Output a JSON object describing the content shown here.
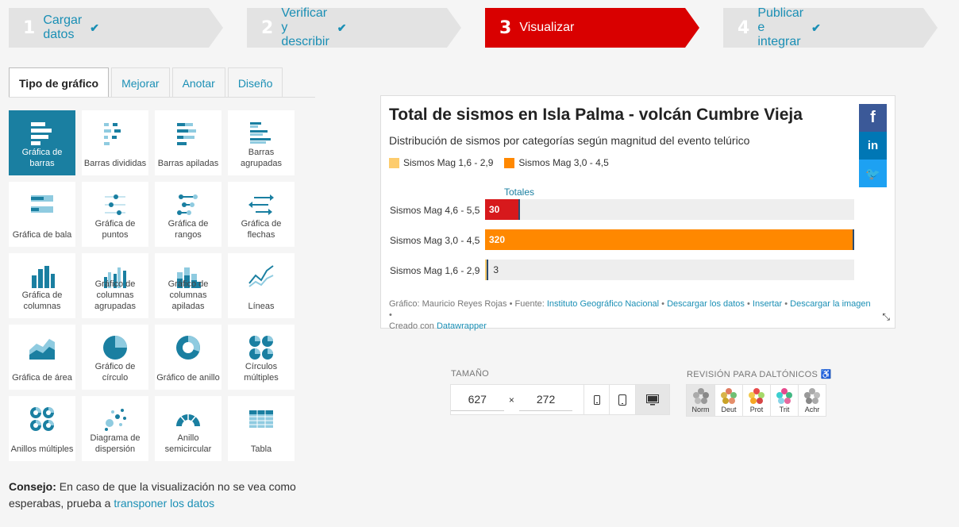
{
  "steps": [
    {
      "num": "1",
      "label": "Cargar datos",
      "check": "✔",
      "state": "done"
    },
    {
      "num": "2",
      "label": "Verificar y describir",
      "check": "✔",
      "state": "done"
    },
    {
      "num": "3",
      "label": "Visualizar",
      "check": "",
      "state": "active"
    },
    {
      "num": "4",
      "label": "Publicar e integrar",
      "check": "✔",
      "state": "done"
    }
  ],
  "tabs": [
    "Tipo de gráfico",
    "Mejorar",
    "Anotar",
    "Diseño"
  ],
  "chart_types": [
    {
      "label": "Gráfica de barras",
      "icon": "bar-chart-icon",
      "active": true
    },
    {
      "label": "Barras divididas",
      "icon": "split-bars-icon"
    },
    {
      "label": "Barras apiladas",
      "icon": "stacked-bars-icon"
    },
    {
      "label": "Barras agrupadas",
      "icon": "grouped-bars-icon"
    },
    {
      "label": "Gráfica de bala",
      "icon": "bullet-chart-icon"
    },
    {
      "label": "Gráfica de puntos",
      "icon": "dot-plot-icon"
    },
    {
      "label": "Gráfica de rangos",
      "icon": "range-plot-icon"
    },
    {
      "label": "Gráfica de flechas",
      "icon": "arrow-plot-icon"
    },
    {
      "label": "Gráfica de columnas",
      "icon": "column-chart-icon"
    },
    {
      "label": "Gráfico de columnas agrupadas",
      "icon": "grouped-columns-icon"
    },
    {
      "label": "Gráfico de columnas apiladas",
      "icon": "stacked-columns-icon"
    },
    {
      "label": "Líneas",
      "icon": "line-chart-icon"
    },
    {
      "label": "Gráfica de área",
      "icon": "area-chart-icon"
    },
    {
      "label": "Gráfico de círculo",
      "icon": "pie-chart-icon"
    },
    {
      "label": "Gráfico de anillo",
      "icon": "donut-chart-icon"
    },
    {
      "label": "Círculos múltiples",
      "icon": "multiple-pies-icon"
    },
    {
      "label": "Anillos múltiples",
      "icon": "multiple-donuts-icon"
    },
    {
      "label": "Diagrama de dispersión",
      "icon": "scatter-plot-icon"
    },
    {
      "label": "Anillo semicircular",
      "icon": "election-donut-icon"
    },
    {
      "label": "Tabla",
      "icon": "table-icon"
    }
  ],
  "tip": {
    "bold": "Consejo:",
    "text": " En caso de que la visualización no se vea como esperabas, prueba a ",
    "link": "transponer los datos"
  },
  "preview": {
    "title": "Total de sismos en Isla Palma - volcán Cumbre Vieja",
    "subtitle": "Distribución de sismos por categorías según magnitud del evento telúrico",
    "legend": [
      {
        "label": "Sismos Mag 1,6 - 2,9",
        "color": "#fdcc6d"
      },
      {
        "label": "Sismos Mag 3,0 - 4,5",
        "color": "#ff8800"
      }
    ],
    "column_header": "Totales",
    "footer": {
      "prefix": "Gráfico: Mauricio Reyes Rojas • Fuente: ",
      "source": "Instituto Geográfico Nacional",
      "sep1": " • ",
      "download": "Descargar los datos",
      "sep2": " • ",
      "embed": "Insertar",
      "sep3": " • ",
      "image": "Descargar la imagen",
      "sep4": " • ",
      "created": "Creado con ",
      "tool": "Datawrapper"
    },
    "social": [
      {
        "glyph": "f",
        "icon": "facebook-icon",
        "color": "#3b5998"
      },
      {
        "glyph": "in",
        "icon": "linkedin-icon",
        "color": "#0077b5"
      },
      {
        "glyph": "🐦",
        "icon": "twitter-icon",
        "color": "#1da1f2"
      }
    ]
  },
  "chart_data": {
    "type": "bar",
    "title": "Total de sismos en Isla Palma - volcán Cumbre Vieja",
    "subtitle": "Distribución de sismos por categorías según magnitud del evento telúrico",
    "categories": [
      "Sismos Mag 4,6 - 5,5",
      "Sismos Mag 3,0 - 4,5",
      "Sismos Mag 1,6 - 2,9"
    ],
    "values": [
      30,
      320,
      3
    ],
    "colors": [
      "#d7191c",
      "#ff8800",
      "#fdcc6d"
    ],
    "series": [
      {
        "name": "Totales",
        "values": [
          30,
          320,
          3
        ]
      }
    ],
    "xlim": [
      0,
      320
    ]
  },
  "size": {
    "label": "TAMAÑO",
    "width": "627",
    "times": "×",
    "height": "272",
    "devices": [
      "mobile-small-icon",
      "mobile-icon",
      "desktop-icon"
    ]
  },
  "colorblind": {
    "label": "REVISIÓN PARA DALTÓNICOS",
    "modes": [
      "Norm",
      "Deut",
      "Prot",
      "Trit",
      "Achr"
    ]
  }
}
